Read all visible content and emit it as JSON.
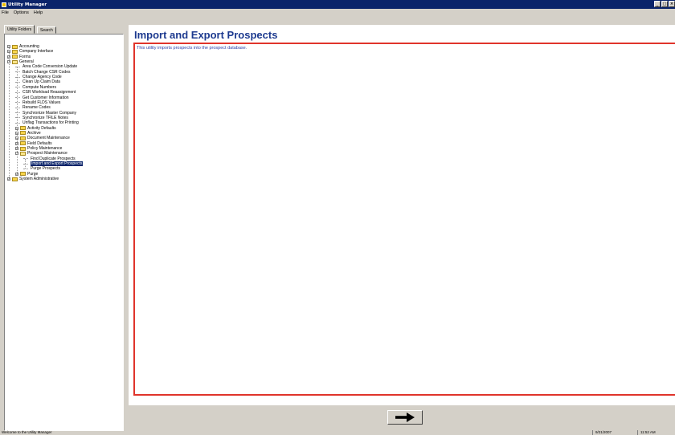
{
  "window": {
    "title": "Utility Manager"
  },
  "menu": [
    "File",
    "Options",
    "Help"
  ],
  "tabs": [
    "Utility Folders",
    "Search"
  ],
  "tree": [
    {
      "label": "Accounting",
      "level": 0,
      "kind": "folder",
      "expander": "+"
    },
    {
      "label": "Company Interface",
      "level": 0,
      "kind": "folder",
      "expander": "+"
    },
    {
      "label": "Forms",
      "level": 0,
      "kind": "folder",
      "expander": "+"
    },
    {
      "label": "General",
      "level": 0,
      "kind": "folder-open",
      "expander": "-"
    },
    {
      "label": "Area Code Conversion Update",
      "level": 1,
      "kind": "leaf"
    },
    {
      "label": "Batch Change CSR Codes",
      "level": 1,
      "kind": "leaf"
    },
    {
      "label": "Change Agency Code",
      "level": 1,
      "kind": "leaf"
    },
    {
      "label": "Clean Up Claim Data",
      "level": 1,
      "kind": "leaf"
    },
    {
      "label": "Compute Numbers",
      "level": 1,
      "kind": "leaf"
    },
    {
      "label": "CSR Workload Reassignment",
      "level": 1,
      "kind": "leaf"
    },
    {
      "label": "Get Customer Information",
      "level": 1,
      "kind": "leaf"
    },
    {
      "label": "Rebuild FLDS Values",
      "level": 1,
      "kind": "leaf"
    },
    {
      "label": "Rename Codes",
      "level": 1,
      "kind": "leaf"
    },
    {
      "label": "Synchronize Master Company",
      "level": 1,
      "kind": "leaf"
    },
    {
      "label": "Synchronize TFILE Notes",
      "level": 1,
      "kind": "leaf"
    },
    {
      "label": "Unflag Transactions for Printing",
      "level": 1,
      "kind": "leaf"
    },
    {
      "label": "Activity Defaults",
      "level": 1,
      "kind": "folder",
      "expander": "+"
    },
    {
      "label": "Archive",
      "level": 1,
      "kind": "folder",
      "expander": "+"
    },
    {
      "label": "Document Maintenance",
      "level": 1,
      "kind": "folder",
      "expander": "+"
    },
    {
      "label": "Field Defaults",
      "level": 1,
      "kind": "folder",
      "expander": "+"
    },
    {
      "label": "Policy Maintenance",
      "level": 1,
      "kind": "folder",
      "expander": "+"
    },
    {
      "label": "Prospect Maintenance",
      "level": 1,
      "kind": "folder-open",
      "expander": "-"
    },
    {
      "label": "Find Duplicate Prospects",
      "level": 2,
      "kind": "leaf"
    },
    {
      "label": "Import and Export Prospects",
      "level": 2,
      "kind": "leaf",
      "selected": true
    },
    {
      "label": "Purge Prospects",
      "level": 2,
      "kind": "leaf"
    },
    {
      "label": "Purge",
      "level": 1,
      "kind": "folder",
      "expander": "+"
    },
    {
      "label": "System Administrative",
      "level": 0,
      "kind": "folder",
      "expander": "+"
    }
  ],
  "main": {
    "title": "Import and Export Prospects",
    "description": "This utility imports prospects into the prospect database."
  },
  "status": {
    "message": "Welcome to the Utility Manager",
    "date": "9/21/2007",
    "time": "11:52 AM"
  },
  "colors": {
    "titlebar": "#0a246a",
    "heading": "#1d3a8f",
    "frame": "#e0342b",
    "selection": "#0a246a"
  }
}
